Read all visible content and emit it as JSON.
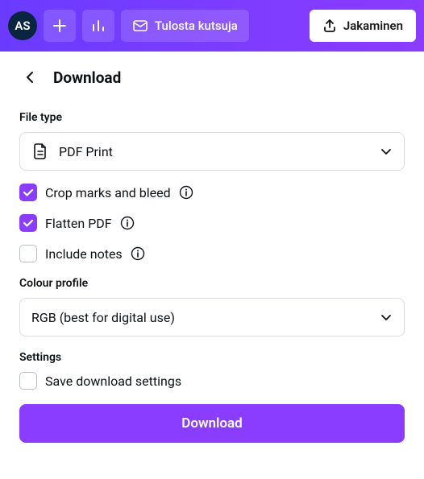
{
  "topbar": {
    "avatar_initials": "AS",
    "print_label": "Tulosta kutsuja",
    "share_label": "Jakaminen"
  },
  "panel": {
    "title": "Download",
    "file_type_label": "File type",
    "file_type_value": "PDF Print",
    "crop_marks_label": "Crop marks and bleed",
    "flatten_label": "Flatten PDF",
    "include_notes_label": "Include notes",
    "colour_profile_label": "Colour profile",
    "colour_profile_value": "RGB (best for digital use)",
    "settings_label": "Settings",
    "save_settings_label": "Save download settings",
    "download_button": "Download"
  }
}
